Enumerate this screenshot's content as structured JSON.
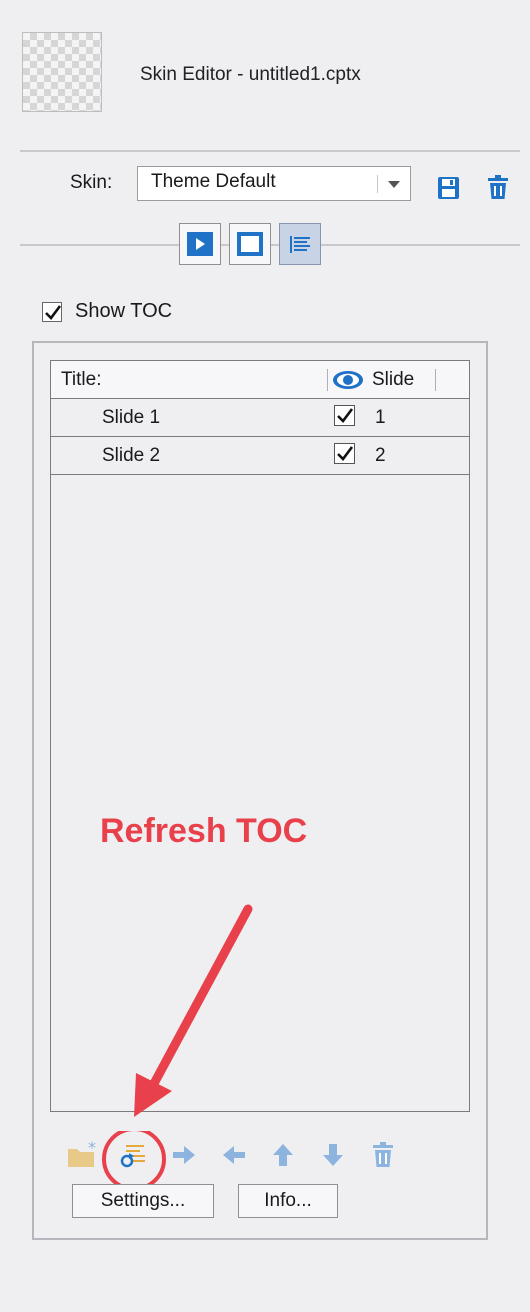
{
  "header": {
    "title": "Skin Editor - untitled1.cptx"
  },
  "skin": {
    "label": "Skin:",
    "selected": "Theme Default"
  },
  "toolbar": {
    "buttons": [
      {
        "name": "playback-tab",
        "icon": "play-icon"
      },
      {
        "name": "borders-tab",
        "icon": "square-icon"
      },
      {
        "name": "toc-tab",
        "icon": "toc-list-icon",
        "selected": true
      }
    ],
    "save_icon": "save-icon",
    "delete_icon": "trash-icon"
  },
  "show_toc": {
    "label": "Show TOC",
    "checked": true
  },
  "toc_table": {
    "columns": {
      "title": "Title:",
      "slide": "Slide"
    },
    "rows": [
      {
        "title": "Slide 1",
        "visible": true,
        "slide": "1"
      },
      {
        "title": "Slide 2",
        "visible": true,
        "slide": "2"
      }
    ]
  },
  "bottom_toolbar": {
    "icons": [
      "new-folder-icon",
      "refresh-toc-icon",
      "move-right-icon",
      "move-left-icon",
      "move-up-icon",
      "move-down-icon",
      "trash-icon"
    ]
  },
  "buttons": {
    "settings": "Settings...",
    "info": "Info..."
  },
  "annotation": {
    "text": "Refresh TOC",
    "color": "#e8414b"
  },
  "colors": {
    "accent_blue": "#1f72c6",
    "light_blue": "#8db3df",
    "folder_yellow": "#e8c987",
    "annotation_red": "#e8414b"
  }
}
